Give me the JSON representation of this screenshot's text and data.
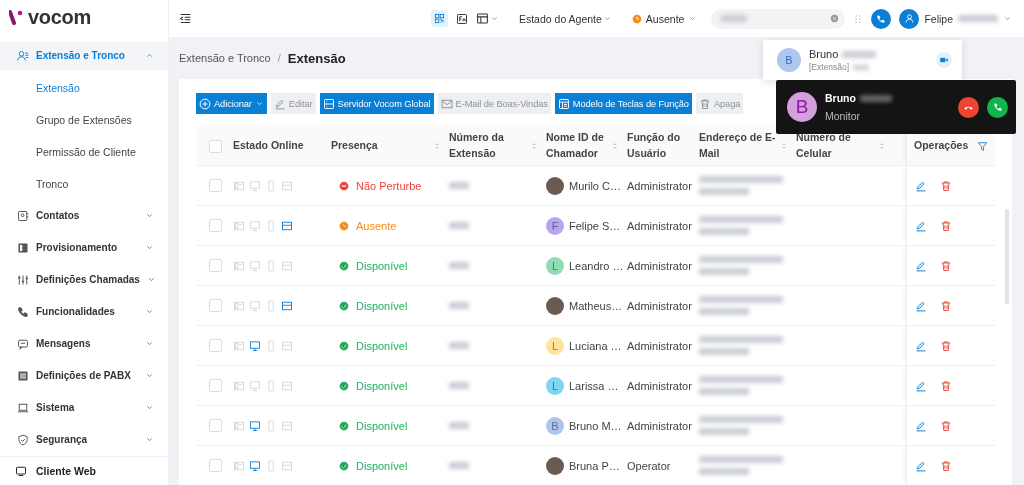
{
  "sidebar": {
    "logo": "vocom",
    "groups": [
      {
        "label": "Extensão e Tronco",
        "expanded": true,
        "children": [
          {
            "label": "Extensão",
            "selected": true
          },
          {
            "label": "Grupo de Extensões",
            "selected": false
          },
          {
            "label": "Permissão de Cliente",
            "selected": false
          },
          {
            "label": "Tronco",
            "selected": false
          }
        ]
      },
      {
        "label": "Contatos",
        "expanded": false
      },
      {
        "label": "Provisionamento",
        "expanded": false
      },
      {
        "label": "Definições Chamadas",
        "expanded": false
      },
      {
        "label": "Funcionalidades",
        "expanded": false
      },
      {
        "label": "Mensagens",
        "expanded": false
      },
      {
        "label": "Definições de PABX",
        "expanded": false
      },
      {
        "label": "Sistema",
        "expanded": false
      },
      {
        "label": "Segurança",
        "expanded": false
      }
    ],
    "footer_link": "Cliente Web"
  },
  "topbar": {
    "agent_status": "Estado do Agente",
    "presence": "Ausente",
    "user_name": "Felipe"
  },
  "breadcrumb": {
    "separator": "/",
    "items": [
      "Extensão e Tronco",
      "Extensão"
    ]
  },
  "toolbar": [
    {
      "label": "Adicionar",
      "disabled": false,
      "dropdown": true
    },
    {
      "label": "Editar",
      "disabled": true,
      "dropdown": false
    },
    {
      "label": "Servidor Vocom Global",
      "disabled": false,
      "dropdown": false
    },
    {
      "label": "E-Mail de Boas-Vindas",
      "disabled": true,
      "dropdown": false
    },
    {
      "label": "Modelo de Teclas de Função",
      "disabled": false,
      "dropdown": false
    },
    {
      "label": "Apaga",
      "disabled": true,
      "dropdown": false
    }
  ],
  "table": {
    "select_all_checked": false,
    "columns": [
      {
        "label": "Estado Online",
        "sortable": false
      },
      {
        "label": "Presença",
        "sortable": true
      },
      {
        "label": "Número da Extensão",
        "sortable": true
      },
      {
        "label": "Nome ID de Chamador",
        "sortable": true
      },
      {
        "label": "Função do Usuário",
        "sortable": false
      },
      {
        "label": "Endereço de E-Mail",
        "sortable": true
      },
      {
        "label": "Número de Celular",
        "sortable": true
      },
      {
        "label": "Operações",
        "sortable": false
      }
    ],
    "rows": [
      {
        "checked": false,
        "devices": {
          "desk_phone": false,
          "desktop": false,
          "mobile": false,
          "web": false
        },
        "presence": {
          "kind": "dnd",
          "label": "Não Perturbe"
        },
        "avatar": {
          "kind": "photo"
        },
        "name": "Murilo C…",
        "role": "Administrator"
      },
      {
        "checked": false,
        "devices": {
          "desk_phone": false,
          "desktop": false,
          "mobile": false,
          "web": true
        },
        "presence": {
          "kind": "away",
          "label": "Ausente"
        },
        "avatar": {
          "kind": "letter",
          "letter": "F",
          "color": "#b7a6ef"
        },
        "name": "Felipe S…",
        "role": "Administrator"
      },
      {
        "checked": false,
        "devices": {
          "desk_phone": false,
          "desktop": false,
          "mobile": false,
          "web": false
        },
        "presence": {
          "kind": "available",
          "label": "Disponível"
        },
        "avatar": {
          "kind": "letter",
          "letter": "L",
          "color": "#8fdcb4"
        },
        "name": "Leandro …",
        "role": "Administrator"
      },
      {
        "checked": false,
        "devices": {
          "desk_phone": false,
          "desktop": false,
          "mobile": false,
          "web": true
        },
        "presence": {
          "kind": "available",
          "label": "Disponível"
        },
        "avatar": {
          "kind": "photo"
        },
        "name": "Matheus…",
        "role": "Administrator"
      },
      {
        "checked": false,
        "devices": {
          "desk_phone": false,
          "desktop": true,
          "mobile": false,
          "web": false
        },
        "presence": {
          "kind": "available",
          "label": "Disponível"
        },
        "avatar": {
          "kind": "letter",
          "letter": "L",
          "color": "#ffe29e"
        },
        "name": "Luciana …",
        "role": "Administrator"
      },
      {
        "checked": false,
        "devices": {
          "desk_phone": false,
          "desktop": false,
          "mobile": false,
          "web": false
        },
        "presence": {
          "kind": "available",
          "label": "Disponível"
        },
        "avatar": {
          "kind": "letter",
          "letter": "L",
          "color": "#7fd6f2"
        },
        "name": "Larissa …",
        "role": "Administrator"
      },
      {
        "checked": false,
        "devices": {
          "desk_phone": false,
          "desktop": true,
          "mobile": false,
          "web": false
        },
        "presence": {
          "kind": "available",
          "label": "Disponível"
        },
        "avatar": {
          "kind": "letter",
          "letter": "B",
          "color": "#adc6ef"
        },
        "name": "Bruno M…",
        "role": "Administrator"
      },
      {
        "checked": false,
        "devices": {
          "desk_phone": false,
          "desktop": true,
          "mobile": false,
          "web": false
        },
        "presence": {
          "kind": "available",
          "label": "Disponível"
        },
        "avatar": {
          "kind": "photo"
        },
        "name": "Bruna P…",
        "role": "Operator"
      }
    ]
  },
  "search_result": {
    "initial": "B",
    "name": "Bruno",
    "subtitle": "[Extensão]"
  },
  "incoming_call": {
    "initial": "B",
    "name": "Bruno",
    "role": "Monitor"
  }
}
